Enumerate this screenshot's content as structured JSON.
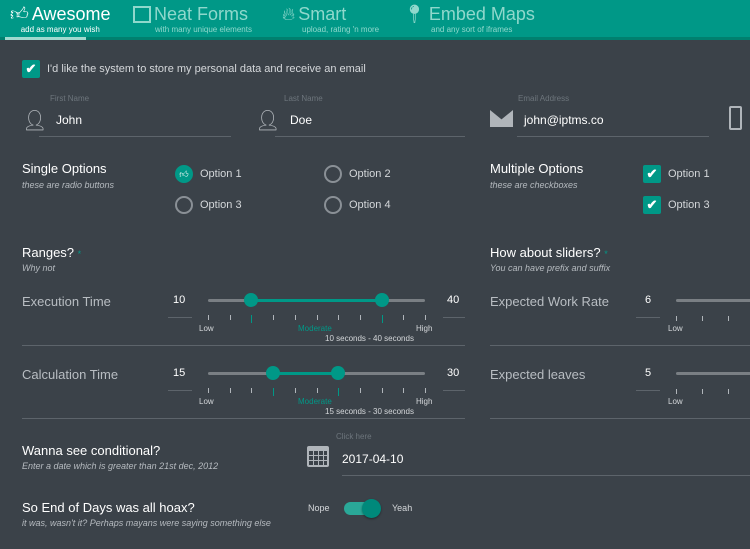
{
  "tabs": [
    {
      "title": "Awesome",
      "subtitle": "add as many you wish",
      "icon": "thumbs-up-icon",
      "active": true
    },
    {
      "title": "Neat Forms",
      "subtitle": "with many unique elements",
      "icon": "form-icon"
    },
    {
      "title": "Smart",
      "subtitle": "upload, rating 'n more",
      "icon": "fire-icon"
    },
    {
      "title": "Embed Maps",
      "subtitle": "and any sort of iframes",
      "icon": "map-marker-icon"
    }
  ],
  "consent": {
    "label": "I'd like the system to store my personal data and receive an email",
    "checked": true
  },
  "fields": {
    "first_name": {
      "label": "First Name",
      "value": "John"
    },
    "last_name": {
      "label": "Last Name",
      "value": "Doe"
    },
    "email": {
      "label": "Email Address",
      "value": "john@iptms.co"
    }
  },
  "single": {
    "title": "Single Options",
    "subtitle": "these are radio buttons",
    "options": [
      "Option 1",
      "Option 2",
      "Option 3",
      "Option 4"
    ],
    "selected": "Option 1"
  },
  "multiple": {
    "title": "Multiple Options",
    "subtitle": "these are checkboxes",
    "options": [
      "Option 1",
      "Option 3"
    ],
    "checked": [
      "Option 1",
      "Option 3"
    ]
  },
  "ranges": {
    "title": "Ranges?",
    "star": "*",
    "subtitle": "Why not",
    "execution": {
      "label": "Execution Time",
      "min_value": "10",
      "max_value": "40",
      "low": "Low",
      "mid": "Moderate",
      "high": "High",
      "summary": "10 seconds - 40 seconds",
      "range": [
        0,
        50
      ],
      "from": 10,
      "to": 40
    },
    "calculation": {
      "label": "Calculation Time",
      "min_value": "15",
      "max_value": "30",
      "low": "Low",
      "mid": "Moderate",
      "high": "High",
      "summary": "15 seconds - 30 seconds",
      "range": [
        0,
        50
      ],
      "from": 15,
      "to": 30
    }
  },
  "sliders": {
    "title": "How about sliders?",
    "star": "*",
    "subtitle": "You can have prefix and suffix",
    "work_rate": {
      "label": "Expected Work Rate",
      "value": "6",
      "low": "Low"
    },
    "leaves": {
      "label": "Expected leaves",
      "value": "5",
      "low": "Low"
    }
  },
  "conditional": {
    "title": "Wanna see conditional?",
    "subtitle": "Enter a date which is greater than 21st dec, 2012",
    "date_label": "Click here",
    "date_value": "2017-04-10"
  },
  "hoax": {
    "title": "So End of Days was all hoax?",
    "subtitle": "it was, wasn't it? Perhaps mayans were saying something else",
    "off_label": "Nope",
    "on_label": "Yeah",
    "on": true
  }
}
